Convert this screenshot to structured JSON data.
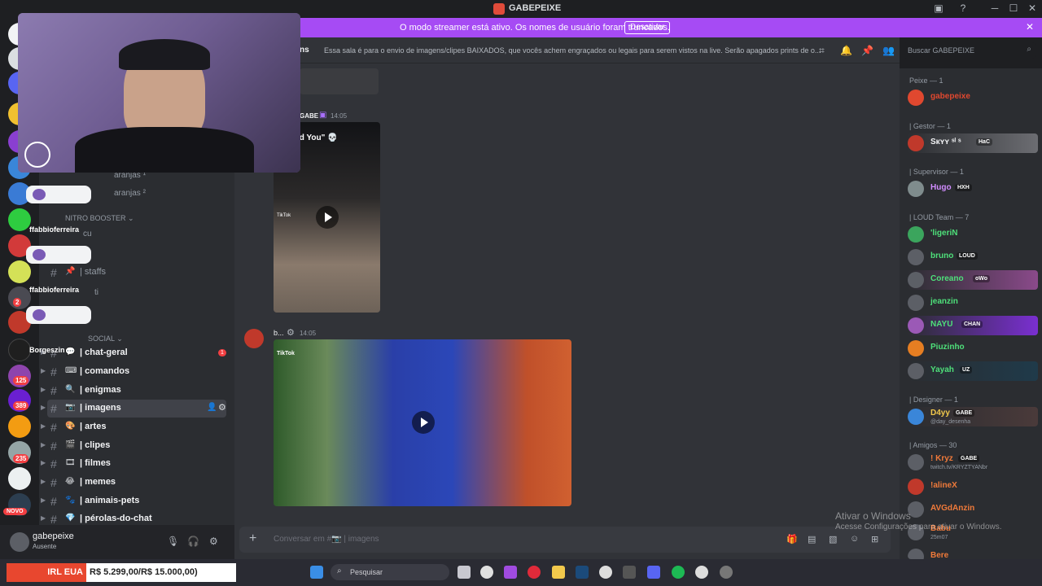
{
  "window": {
    "title": "GABEPEIXE"
  },
  "banner": {
    "message": "O modo streamer está ativo. Os nomes de usuário foram truncados.",
    "button_label": "Desativar"
  },
  "rail": {
    "badges": [
      "2",
      "125",
      "389",
      "235"
    ],
    "new_label": "NOVO"
  },
  "overlay_names": [
    "ffabbioferreira",
    "ffabbioferreira",
    "Borgeszin"
  ],
  "sidebar": {
    "partial_items": [
      "aranjas ¹",
      "aranjas ²",
      "cu",
      "ti"
    ],
    "categories": [
      "NITRO BOOSTER",
      "SOCIAL"
    ],
    "staffs": "| staffs",
    "channels": [
      {
        "emoji": "💬",
        "label": "| chat-geral",
        "unread": "1"
      },
      {
        "emoji": "⌨",
        "label": "| comandos"
      },
      {
        "emoji": "🔍",
        "label": "| enigmas"
      },
      {
        "emoji": "📷",
        "label": "| imagens"
      },
      {
        "emoji": "🎨",
        "label": "| artes"
      },
      {
        "emoji": "🎬",
        "label": "| clipes"
      },
      {
        "emoji": "🎞",
        "label": "| filmes"
      },
      {
        "emoji": "😂",
        "label": "| memes"
      },
      {
        "emoji": "🐾",
        "label": "| animais-pets"
      },
      {
        "emoji": "💎",
        "label": "| pérolas-do-chat"
      }
    ]
  },
  "user": {
    "name": "gabepeixe",
    "status": "Ausente"
  },
  "header": {
    "channel": "ns",
    "topic": "Essa sala é para o envio de imagens/clipes BAIXADOS, que vocês achem engraçados ou legais para serem vistos na live. Serão apagados prints de o...",
    "search_placeholder": "Buscar GABEPEIXE"
  },
  "messages": [
    {
      "author": "GABE",
      "time": "14:05",
      "caption": "Behind You\" 💀",
      "watermark": "TikTok"
    },
    {
      "author": "b...",
      "time": "14:05",
      "watermark": "TikTok"
    }
  ],
  "composer": {
    "placeholder": "Conversar em #📷 | imagens"
  },
  "members": {
    "groups": [
      {
        "role": "Peixe — 1",
        "list": [
          {
            "name": "gabepeixe",
            "color": "#e0482f"
          }
        ]
      },
      {
        "role": "| Gestor — 1",
        "list": [
          {
            "name": "Sкʏʏ ˢˡ ˢ",
            "color": "#f2f3f5",
            "tag": "HaC"
          }
        ]
      },
      {
        "role": "| Supervisor — 1",
        "list": [
          {
            "name": "Hugo",
            "color": "#d18cff",
            "tag": "HXH"
          }
        ]
      },
      {
        "role": "| LOUD Team — 7",
        "list": [
          {
            "name": "'ligeriN",
            "color": "#4ee07a"
          },
          {
            "name": "bruno",
            "color": "#4ee07a",
            "tag": "LOUD"
          },
          {
            "name": "Coreano",
            "color": "#4ee07a",
            "tag": "oWo"
          },
          {
            "name": "jeanzin",
            "color": "#4ee07a"
          },
          {
            "name": "NAYU",
            "color": "#4ee07a",
            "tag": "CHAN"
          },
          {
            "name": "Piuzinho",
            "color": "#4ee07a"
          },
          {
            "name": "Yayah",
            "color": "#4ee07a",
            "tag": "UZ"
          }
        ]
      },
      {
        "role": "| Designer — 1",
        "list": [
          {
            "name": "D4yy",
            "color": "#f2c94c",
            "tag": "GABE",
            "sub": "@day_desenha"
          }
        ]
      },
      {
        "role": "| Amigos — 30",
        "list": [
          {
            "name": "! Kryz",
            "color": "#f07a3a",
            "tag": "GABE",
            "sub": "twitch.tv/KRYZTYANbr"
          },
          {
            "name": "!alineX",
            "color": "#f07a3a"
          },
          {
            "name": "AVGdAnzin",
            "color": "#f07a3a"
          },
          {
            "name": "Babu",
            "color": "#f07a3a",
            "sub": "25m07"
          },
          {
            "name": "Bere",
            "color": "#f07a3a"
          }
        ]
      }
    ]
  },
  "watermark": {
    "line1": "Ativar o Windows",
    "line2": "Acesse Configurações para ativar o Windows."
  },
  "taskbar": {
    "ticker_label": "IRL EUA",
    "ticker_value": "R$ 5.299,00/R$ 15.000,00)",
    "search_placeholder": "Pesquisar"
  },
  "colors": {
    "banner": "#a64bf4",
    "accent": "#5865f2",
    "chat_bg": "#313338"
  }
}
